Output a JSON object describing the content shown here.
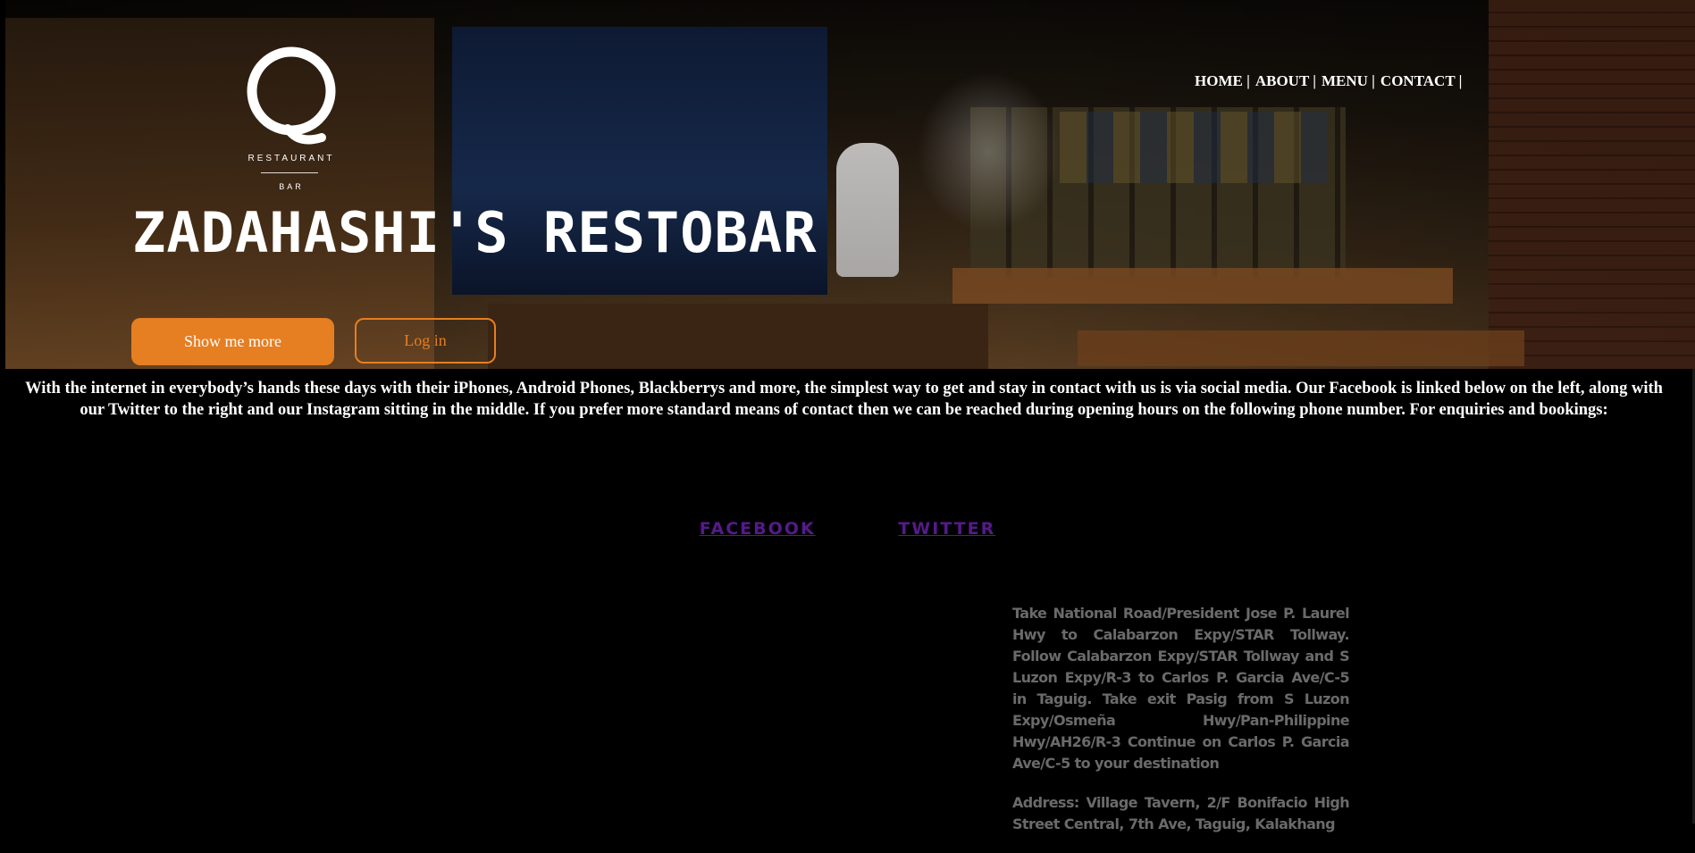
{
  "logo": {
    "line1": "RESTAURANT",
    "line2": "BAR"
  },
  "nav": {
    "items": [
      "HOME |",
      "ABOUT |",
      "MENU |",
      "CONTACT |"
    ]
  },
  "hero": {
    "title": "ZADAHASHI'S RESTOBAR",
    "primary_button": "Show me more",
    "secondary_button": "Log in"
  },
  "intro_text": "With the internet in everybody’s hands these days with their iPhones, Android Phones, Blackberrys and more, the simplest way to get and stay in contact with us is via social media. Our Facebook is linked below on the left, along with our Twitter to the right and our Instagram sitting in the middle. If you prefer more standard means of contact then we can be reached during opening hours on the following phone number. For enquiries and bookings:",
  "social": {
    "facebook": "FACEBOOK",
    "twitter": "TWITTER"
  },
  "directions": {
    "route": "Take National Road/President Jose P. Laurel Hwy to Calabarzon Expy/STAR Tollway. Follow Calabarzon Expy/STAR Tollway and S Luzon Expy/R-3 to Carlos P. Garcia Ave/C-5 in Taguig. Take exit Pasig from S Luzon Expy/Osmeña Hwy/Pan-Philippine Hwy/AH26/R-3 Continue on Carlos P. Garcia Ave/C-5 to your destination",
    "address": "Address: Village Tavern, 2/F Bonifacio High Street Central, 7th Ave, Taguig, Kalakhang"
  },
  "colors": {
    "accent": "#e67e22",
    "link_visited": "#551a8b",
    "muted_text": "#6a6a6a",
    "background": "#000000"
  }
}
